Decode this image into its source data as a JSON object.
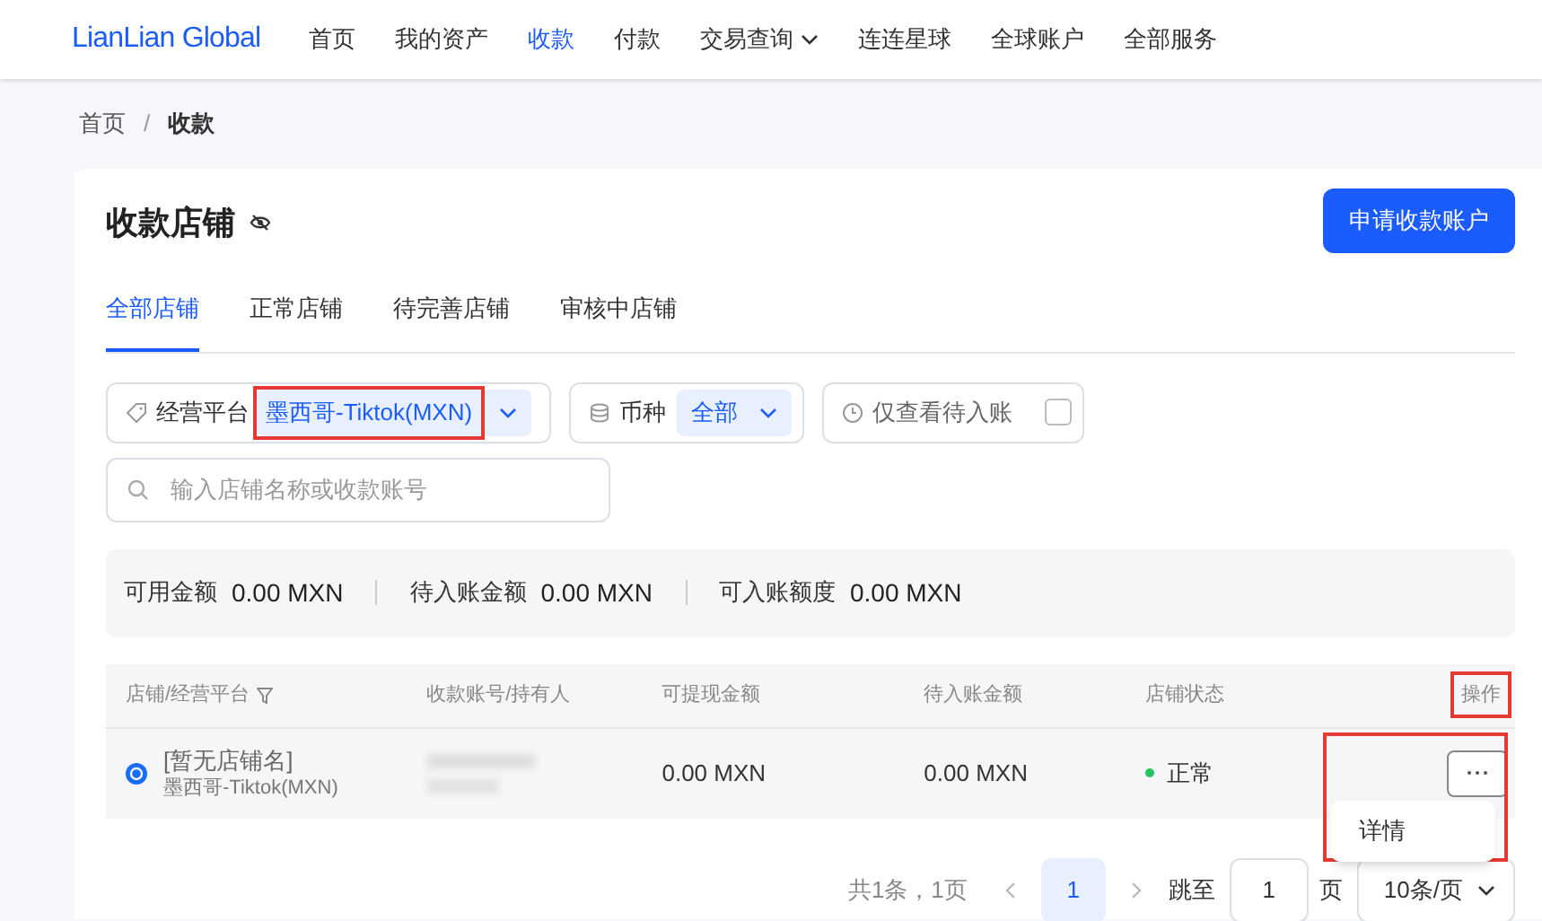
{
  "nav": {
    "logo": "LianLian Global",
    "items": [
      {
        "label": "首页",
        "selected": false,
        "dropdown": false
      },
      {
        "label": "我的资产",
        "selected": false,
        "dropdown": false
      },
      {
        "label": "收款",
        "selected": true,
        "dropdown": false
      },
      {
        "label": "付款",
        "selected": false,
        "dropdown": false
      },
      {
        "label": "交易查询",
        "selected": false,
        "dropdown": true
      },
      {
        "label": "连连星球",
        "selected": false,
        "dropdown": false
      },
      {
        "label": "全球账户",
        "selected": false,
        "dropdown": false
      },
      {
        "label": "全部服务",
        "selected": false,
        "dropdown": false
      }
    ]
  },
  "breadcrumb": [
    "首页",
    "收款"
  ],
  "breadcrumb_separator": "/",
  "page_title": "收款店铺",
  "primary_button": "申请收款账户",
  "tabs": [
    {
      "label": "全部店铺",
      "selected": true
    },
    {
      "label": "正常店铺",
      "selected": false
    },
    {
      "label": "待完善店铺",
      "selected": false
    },
    {
      "label": "审核中店铺",
      "selected": false
    }
  ],
  "filters": {
    "platform": {
      "label": "经营平台",
      "value": "墨西哥-Tiktok(MXN)"
    },
    "currency": {
      "label": "币种",
      "value": "全部"
    },
    "pending_only": {
      "label": "仅查看待入账",
      "checked": false
    },
    "search": {
      "placeholder": "输入店铺名称或收款账号"
    }
  },
  "summary": [
    {
      "label": "可用金额",
      "value": "0.00 MXN"
    },
    {
      "label": "待入账金额",
      "value": "0.00 MXN"
    },
    {
      "label": "可入账额度",
      "value": "0.00 MXN"
    }
  ],
  "table": {
    "columns": [
      "店铺/经营平台",
      "收款账号/持有人",
      "可提现金额",
      "待入账金额",
      "店铺状态",
      "操作"
    ],
    "rows": [
      {
        "store": "[暂无店铺名]",
        "platform": "墨西哥-Tiktok(MXN)",
        "withdrawable": "0.00 MXN",
        "pending": "0.00 MXN",
        "status": "正常",
        "color": "#22c55e"
      }
    ]
  },
  "row_menu": [
    "详情"
  ],
  "pagination": {
    "summary": "共1条，1页",
    "pages": [
      {
        "label": "1",
        "selected": true
      }
    ],
    "jump_label": "跳至",
    "jump_value": "1",
    "page_unit": "页",
    "page_size": "10条/页"
  }
}
